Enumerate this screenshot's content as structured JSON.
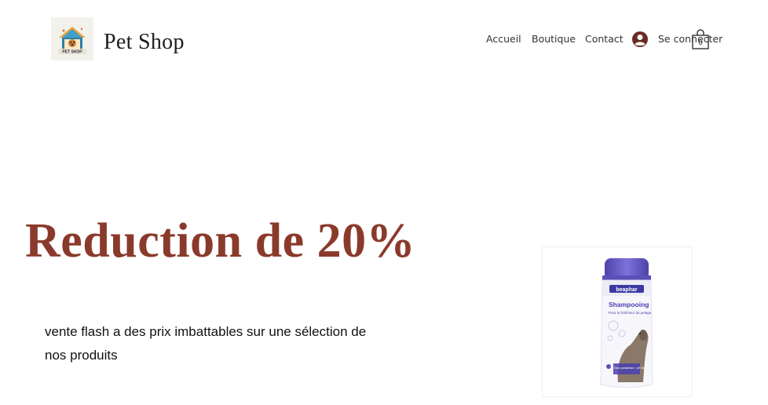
{
  "header": {
    "brand": "Pet Shop",
    "logo_text": "PET SHOP",
    "logo_icon": "doghouse-icon",
    "nav": [
      {
        "label": "Accueil"
      },
      {
        "label": "Boutique"
      },
      {
        "label": "Contact"
      }
    ],
    "login_label": "Se connecter",
    "user_icon": "user-avatar-icon",
    "cart_icon": "shopping-bag-icon",
    "cart_count": "0"
  },
  "hero": {
    "title": "Reduction de 20%",
    "description": "vente flash a des prix imbattables sur une sélection de nos produits"
  },
  "product": {
    "brand_label": "beaphar",
    "name": "Shampooing",
    "subtitle": "Pour la fraîcheur du pelage",
    "footnote": "Sans parabènes · pH Neutre · Extra doux"
  },
  "colors": {
    "accent": "#8a3a2b",
    "icon_dark": "#6b2a24",
    "bottle_purple": "#6b5fc8"
  }
}
